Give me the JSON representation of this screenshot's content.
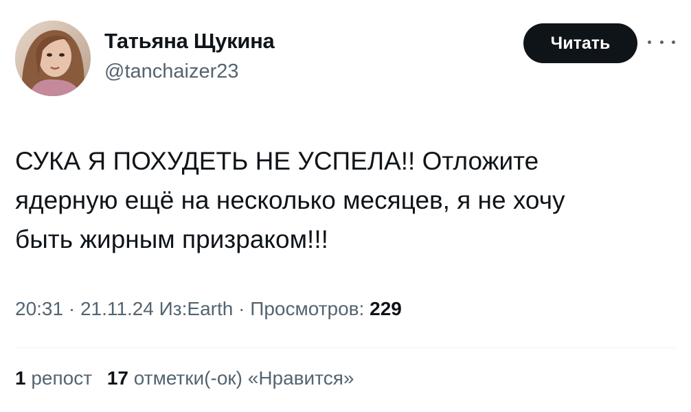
{
  "author": {
    "name": "Татьяна Щукина",
    "handle": "@tanchaizer23"
  },
  "follow_button": {
    "label": "Читать"
  },
  "more_icon": "more-horizontal-icon",
  "tweet": {
    "lines": [
      "СУКА Я ПОХУДЕТЬ НЕ УСПЕЛА!! Отложите",
      "ядерную ещё на несколько месяцев, я не хочу",
      "быть жирным призраком!!!"
    ]
  },
  "meta": {
    "time": "20:31",
    "separator": "·",
    "date": "21.11.24",
    "source": "Из:Earth",
    "views_label": "Просмотров:",
    "views_count": "229"
  },
  "stats": {
    "reposts_count": "1",
    "reposts_label": "репост",
    "likes_count": "17",
    "likes_label": "отметки(-ок) «Нравится»"
  },
  "colors": {
    "text": "#0f1419",
    "secondary": "#536471",
    "button_bg": "#0f1419",
    "button_text": "#ffffff",
    "divider": "#eff3f4"
  }
}
